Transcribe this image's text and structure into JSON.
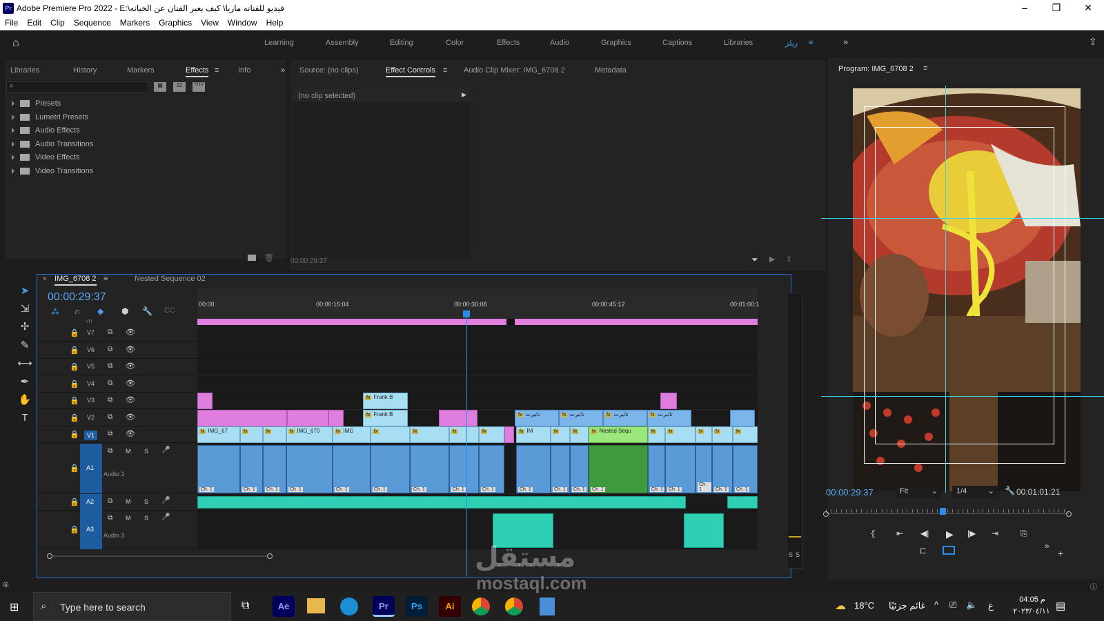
{
  "window": {
    "title": "Adobe Premiere Pro 2022 - E:\\فيديو للفنانه ماريا\\ كيف يعبر الفنان عن الخيانه",
    "min": "–",
    "max": "❐",
    "close": "✕"
  },
  "menu": [
    "File",
    "Edit",
    "Clip",
    "Sequence",
    "Markers",
    "Graphics",
    "View",
    "Window",
    "Help"
  ],
  "workspaces": [
    "Learning",
    "Assembly",
    "Editing",
    "Color",
    "Effects",
    "Audio",
    "Graphics",
    "Captions",
    "Libraries"
  ],
  "workspace_custom": "ريلز",
  "left_panel": {
    "tabs": [
      "Libraries",
      "History",
      "Markers",
      "Effects",
      "Info"
    ],
    "active_tab": "Effects",
    "tree": [
      "Presets",
      "Lumetri Presets",
      "Audio Effects",
      "Audio Transitions",
      "Video Effects",
      "Video Transitions"
    ]
  },
  "source_panel": {
    "tabs": [
      "Source: (no clips)",
      "Effect Controls",
      "Audio Clip Mixer: IMG_6708 2",
      "Metadata"
    ],
    "no_clip": "(no clip selected)",
    "timecode": "00:00:29:37"
  },
  "timeline": {
    "tabs": [
      "IMG_6708 2",
      "Nested Sequence 02"
    ],
    "timecode": "00:00:29:37",
    "ruler": [
      "00:00",
      "00:00:15:04",
      "00:00:30:08",
      "00:00:45:12",
      "00:01:00:1"
    ],
    "video_tracks": [
      "V7",
      "V6",
      "V5",
      "V4",
      "V3",
      "V2",
      "V1"
    ],
    "audio_tracks": [
      {
        "id": "A1",
        "name": "Audio 1"
      },
      {
        "id": "A2",
        "name": ""
      },
      {
        "id": "A3",
        "name": "Audio 3"
      }
    ],
    "clip_labels": {
      "v1a": "IMG_67",
      "v1b": "IMG_670",
      "v1c": "IMG",
      "v1d": "IM",
      "nested": "Nested Sequ",
      "frank1": "Frank B",
      "frank2": "Frank B",
      "tathir": "تاثيرت",
      "ch": "Ch. 1"
    },
    "vr": "VR",
    "ms": "M",
    "ss": "S"
  },
  "program": {
    "title": "Program: IMG_6708 2",
    "timecode": "00:00:29:37",
    "fit": "Fit",
    "resolution": "1/4",
    "duration": "00:01:01:21",
    "playhead_fraction": 0.48
  },
  "taskbar": {
    "search": "Type here to search",
    "weather_temp": "18°C",
    "weather_text": "غائم جزئيًا",
    "time": "04:05 م",
    "date": "٢٠٢٣/٠٤/١١",
    "lang": "ع",
    "apps": [
      "Ae",
      "Pr",
      "Ps",
      "Ai"
    ]
  },
  "watermark": {
    "ar": "مستقل",
    "en": "mostaql.com"
  },
  "colors": {
    "accent": "#2d8ceb",
    "timecode": "#5aa9f3",
    "pink": "#e07ee0",
    "lightblue": "#a8def3",
    "teal": "#2ecfb3"
  }
}
